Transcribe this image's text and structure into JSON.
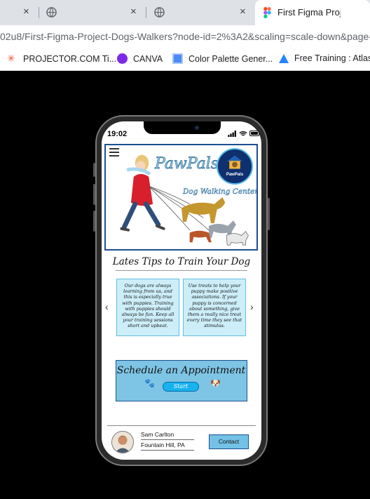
{
  "browser": {
    "tabs": [
      {
        "title": ""
      },
      {
        "title": ""
      },
      {
        "title": ""
      },
      {
        "title": "First Figma Project"
      }
    ],
    "close_glyph": "×",
    "url": "02u8/First-Figma-Project-Dogs-Walkers?node-id=2%3A2&scaling=scale-down&page-",
    "bookmarks": [
      {
        "label": "PROJECTOR.COM Ti...",
        "icon": "projector-icon",
        "color": "#e8583d"
      },
      {
        "label": "CANVA",
        "icon": "canva-icon",
        "color": "#7d2ae8"
      },
      {
        "label": "Color Palette Gener...",
        "icon": "palette-icon",
        "color": "#4c8bf5"
      },
      {
        "label": "Free Training : Atlas...",
        "icon": "atlassian-icon",
        "color": "#2684ff"
      }
    ]
  },
  "phone": {
    "time": "19:02",
    "brand": "PawPals",
    "logo_text": "PawPals",
    "tagline": "Dog Walking Center",
    "tips_title": "Lates Tips to Train Your Dog",
    "cards": [
      {
        "text": "Our dogs are always learning from us, and this is especially true with puppies. Training with puppies should always be fun. Keep all your training sessions short and upbeat."
      },
      {
        "text": "Use treats to help your puppy make positive associations. If your puppy is concerned about something, give them a really nice treat every time they see that stimulus."
      }
    ],
    "prev_arrow": "‹",
    "next_arrow": "›",
    "appointment_title": "Schedule an Appointment",
    "start_label": "Start",
    "footer": {
      "name": "Sam Carlton",
      "location": "Fountain Hill, PA",
      "contact_label": "Contact"
    },
    "colors": {
      "accent": "#7ec4e4",
      "card_bg": "#cdeef8",
      "border": "#1d4f91",
      "start_button": "#18b2f0"
    }
  }
}
